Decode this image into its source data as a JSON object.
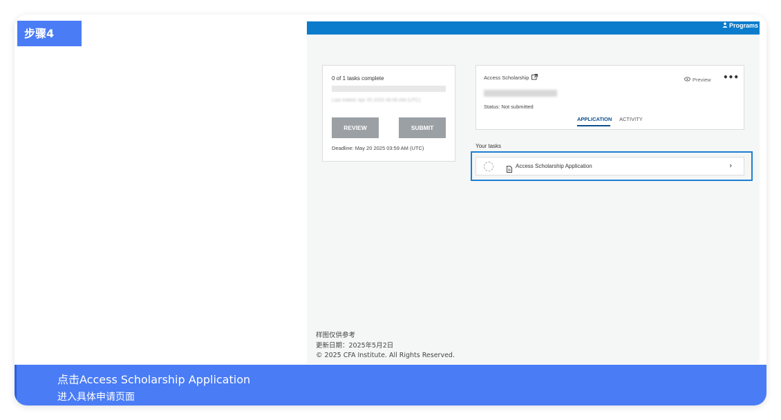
{
  "step": {
    "label": "步骤4"
  },
  "header": {
    "programs_label": "Programs"
  },
  "left_panel": {
    "tasks_complete": "0 of 1 tasks complete",
    "progress_fraction": 0,
    "last_edited": "Last edited: Apr 25 2025 06:06 AM (UTC)",
    "review_label": "REVIEW",
    "submit_label": "SUBMIT",
    "deadline": "Deadline: May 20 2025 03:59 AM (UTC)"
  },
  "right_panel": {
    "title": "Access Scholarship",
    "status": "Status: Not submitted",
    "preview_label": "Preview",
    "more_label": "•••",
    "tabs": [
      {
        "label": "APPLICATION"
      },
      {
        "label": "ACTIVITY"
      }
    ]
  },
  "your_tasks": {
    "heading": "Your tasks",
    "items": [
      {
        "label": "Access Scholarship Application"
      }
    ]
  },
  "footer": {
    "line1": "样图仅供参考",
    "line2": "更新日期：2025年5月2日",
    "line3": "© 2025 CFA Institute. All Rights Reserved."
  },
  "caption": {
    "line1": "点击Access Scholarship Application",
    "line2": "进入具体申请页面"
  },
  "colors": {
    "accent": "#4a7cf6",
    "topbar": "#0b7ccc",
    "highlight": "#1a7fd4",
    "button": "#9ba0a5"
  }
}
